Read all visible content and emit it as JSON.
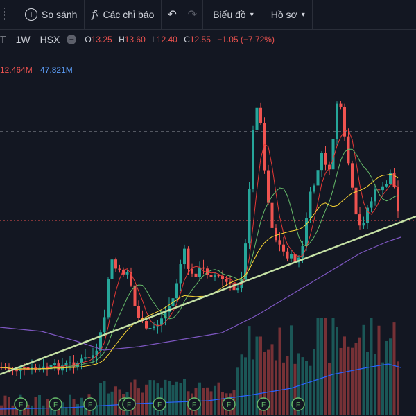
{
  "toolbar": {
    "compare_label": "So sánh",
    "indicators_label": "Các chỉ báo",
    "chart_label": "Biểu đồ",
    "profile_label": "Hồ sơ"
  },
  "legend": {
    "symbol_tail": "T",
    "interval": "1W",
    "exchange": "HSX",
    "o_key": "O",
    "o_val": "13.25",
    "h_key": "H",
    "h_val": "13.60",
    "l_key": "L",
    "l_val": "12.40",
    "c_key": "C",
    "c_val": "12.55",
    "change": "−1.05 (−7.72%)",
    "vol_1": "12.464M",
    "vol_2": "47.821M"
  },
  "colors": {
    "background": "#131722",
    "up": "#26a69a",
    "down": "#ef5350",
    "ma_red": "#e53935",
    "ma_green": "#66bb6a",
    "ma_yellow": "#fdd835",
    "ma_purple": "#7e57c2",
    "vol_ma": "#2962ff",
    "trendline": "#c5e1a5",
    "accent_blue": "#5b9cf6"
  },
  "icons": {
    "compare": "plus-circle-icon",
    "indicators": "function-icon",
    "undo": "undo-icon",
    "redo": "redo-icon",
    "dividend": "dividend-f-icon"
  },
  "dividend_marker_label": "F",
  "dividend_marker_count": 10,
  "chart_data": {
    "type": "candlestick",
    "interval": "1W",
    "last_candle": {
      "open": 13.25,
      "high": 13.6,
      "low": 12.4,
      "close": 12.55
    },
    "change": -1.05,
    "change_pct": -7.72,
    "volume_ma_values": [
      "12.464M",
      "47.821M"
    ],
    "shape_notes": "Price series rises from a flat base, two swing highs in the middle and late sections, falling last bar; ascending trendline under lows; four moving averages (red, green, yellow, purple); volume bars at bottom with a volume moving average",
    "grid": false
  }
}
